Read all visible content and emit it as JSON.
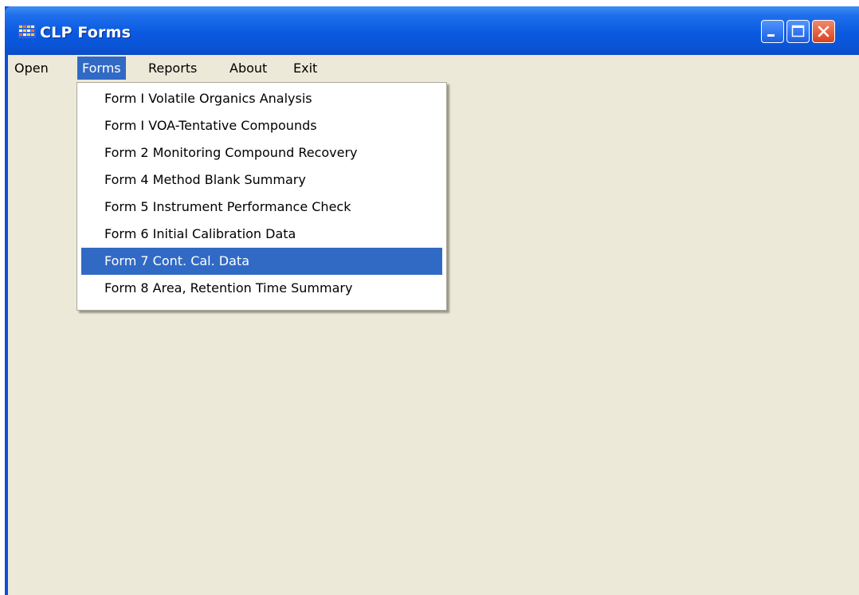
{
  "window": {
    "title": "CLP Forms",
    "controls": {
      "minimize_icon": "minimize-icon",
      "maximize_icon": "maximize-icon",
      "close_icon": "close-icon"
    }
  },
  "menubar": {
    "items": [
      {
        "label": "Open"
      },
      {
        "label": "Forms"
      },
      {
        "label": "Reports"
      },
      {
        "label": "About"
      },
      {
        "label": "Exit"
      }
    ],
    "active": "Forms"
  },
  "forms_menu": {
    "items": [
      {
        "label": "Form I Volatile Organics Analysis"
      },
      {
        "label": "Form I VOA-Tentative Compounds"
      },
      {
        "label": "Form 2 Monitoring Compound Recovery"
      },
      {
        "label": "Form 4 Method Blank Summary"
      },
      {
        "label": "Form 5 Instrument Performance Check"
      },
      {
        "label": "Form 6 Initial Calibration Data"
      },
      {
        "label": "Form 7 Cont. Cal. Data"
      },
      {
        "label": "Form 8 Area, Retention Time Summary"
      }
    ],
    "highlighted": "Form 7 Cont. Cal. Data"
  },
  "colors": {
    "titlebar": "#0a55d8",
    "client_bg": "#ece9d8",
    "highlight": "#316ac5"
  }
}
